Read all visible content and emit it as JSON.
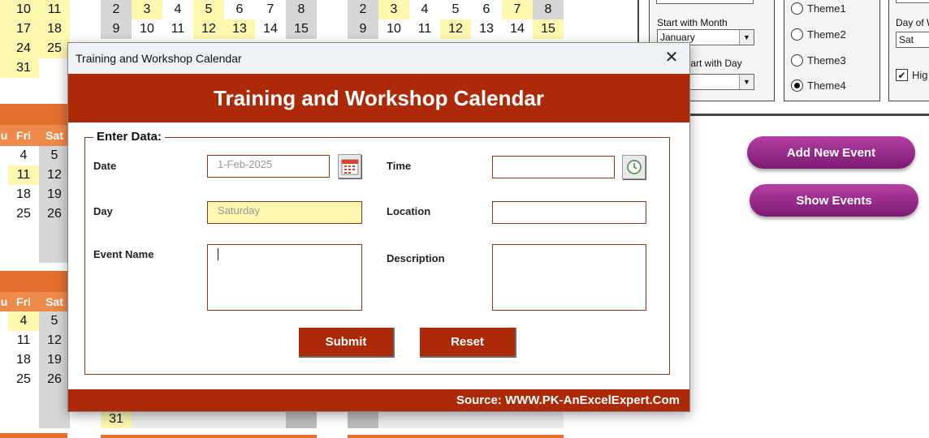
{
  "background": {
    "left_calendar": {
      "top_rows": [
        [
          "10",
          "11"
        ],
        [
          "17",
          "18"
        ],
        [
          "24",
          "25"
        ],
        [
          "31",
          ""
        ]
      ],
      "mid_header": [
        "u",
        "Fri",
        "Sat"
      ],
      "mid_rows": [
        [
          "4",
          "5"
        ],
        [
          "11",
          "12"
        ],
        [
          "18",
          "19"
        ],
        [
          "25",
          "26"
        ]
      ],
      "bot_header": [
        "u",
        "Fri",
        "Sat"
      ],
      "bot_rows": [
        [
          "4",
          "5"
        ],
        [
          "11",
          "12"
        ],
        [
          "18",
          "19"
        ],
        [
          "25",
          "26"
        ]
      ]
    },
    "calendar_b": {
      "row1": [
        "2",
        "3",
        "4",
        "5",
        "6",
        "7",
        "8"
      ],
      "row2": [
        "9",
        "10",
        "11",
        "12",
        "13",
        "14",
        "15"
      ],
      "last": "31"
    },
    "calendar_c": {
      "row1": [
        "2",
        "3",
        "4",
        "5",
        "6",
        "7",
        "8"
      ],
      "row2": [
        "9",
        "10",
        "11",
        "12",
        "13",
        "14",
        "15"
      ]
    }
  },
  "settings": {
    "start_month_label": "Start with Month",
    "start_month_value": "January",
    "start_day_label": "tart with Day",
    "themes": [
      "Theme1",
      "Theme2",
      "Theme3",
      "Theme4"
    ],
    "selected_theme": "Theme4",
    "day_of_week_label": "Day of W",
    "day_of_week_value": "Sat",
    "highlight_label": "Hig"
  },
  "actions": {
    "add_event": "Add New Event",
    "show_events": "Show Events"
  },
  "dialog": {
    "window_title": "Training and Workshop Calendar",
    "banner": "Training and Workshop Calendar",
    "legend": "Enter Data:",
    "date_label": "Date",
    "date_value": "1-Feb-2025",
    "time_label": "Time",
    "time_value": "",
    "day_label": "Day",
    "day_value": "Saturday",
    "location_label": "Location",
    "location_value": "",
    "event_name_label": "Event Name",
    "event_name_value": "",
    "description_label": "Description",
    "description_value": "",
    "submit": "Submit",
    "reset": "Reset",
    "footer": "Source: WWW.PK-AnExcelExpert.Com"
  },
  "colors": {
    "accent": "#ad2a08",
    "weekend_header": "#ee8a4a",
    "pill": "#8e2484",
    "highlight_yellow": "#fdf7b0"
  }
}
